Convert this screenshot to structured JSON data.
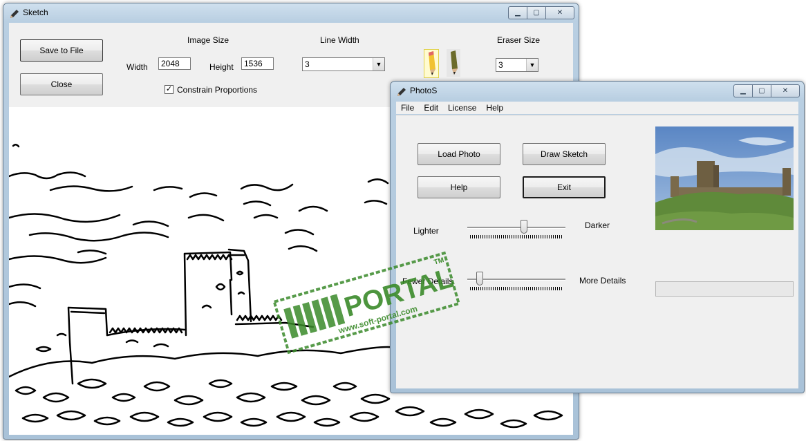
{
  "sketch_window": {
    "title": "Sketch",
    "save_button": "Save to File",
    "close_button": "Close",
    "image_size_label": "Image Size",
    "width_label": "Width",
    "width_value": "2048",
    "height_label": "Height",
    "height_value": "1536",
    "constrain_label": "Constrain Proportions",
    "constrain_checked": true,
    "line_width_label": "Line Width",
    "line_width_value": "3",
    "eraser_size_label": "Eraser Size",
    "eraser_size_value": "3",
    "tools": [
      "pencil-icon",
      "eraser-pencil-icon"
    ]
  },
  "photos_window": {
    "title": "PhotoS",
    "menu": [
      "File",
      "Edit",
      "License",
      "Help"
    ],
    "load_photo_button": "Load Photo",
    "draw_sketch_button": "Draw Sketch",
    "help_button": "Help",
    "exit_button": "Exit",
    "lighter_label": "Lighter",
    "darker_label": "Darker",
    "lightness_level": 0.58,
    "fewer_details_label": "Fewer Details",
    "more_details_label": "More Details",
    "detail_level": 0.1,
    "progress": 0
  },
  "watermark": {
    "brand": "PORTAL",
    "url": "www.soft-portal.com",
    "tm": "TM"
  },
  "colors": {
    "watermark_green": "#3a8a2a",
    "titlebar": "#b9cfe2"
  }
}
